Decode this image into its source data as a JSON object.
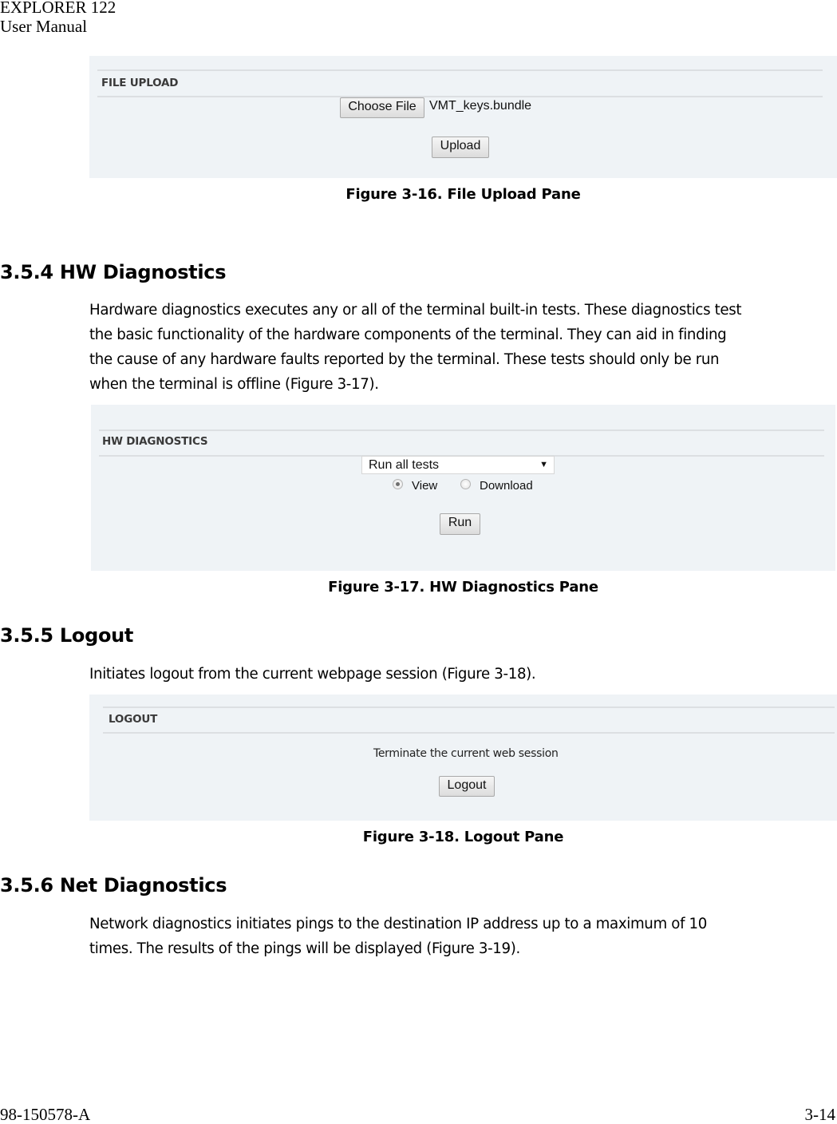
{
  "header": {
    "product": "EXPLORER 122",
    "doc_type": "User Manual"
  },
  "figures": {
    "file_upload": {
      "pane_title": "FILE UPLOAD",
      "choose_file_label": "Choose File",
      "selected_file": "VMT_keys.bundle",
      "upload_label": "Upload",
      "caption": "Figure 3-16. File Upload Pane"
    },
    "hw_diagnostics": {
      "pane_title": "HW DIAGNOSTICS",
      "test_select_value": "Run all tests",
      "test_select_arrow": "▼",
      "output_options": [
        {
          "label": "View",
          "checked": true
        },
        {
          "label": "Download",
          "checked": false
        }
      ],
      "run_label": "Run",
      "caption": "Figure 3-17. HW Diagnostics Pane"
    },
    "logout": {
      "pane_title": "LOGOUT",
      "description": "Terminate the current web session",
      "logout_label": "Logout",
      "caption": "Figure 3-18. Logout Pane"
    }
  },
  "sections": {
    "hw_diagnostics": {
      "heading": "3.5.4 HW Diagnostics",
      "lines": [
        "Hardware diagnostics executes any or all of the terminal built-in tests. These diagnostics test",
        "the basic functionality of the hardware components of the terminal. They can aid in finding",
        "the cause of any hardware faults reported by the terminal. These tests should only be run",
        "when the terminal is offline (Figure 3-17)."
      ]
    },
    "logout": {
      "heading": "3.5.5 Logout",
      "lines": [
        "Initiates logout from the current webpage session (Figure 3-18)."
      ]
    },
    "net_diagnostics": {
      "heading": "3.5.6 Net Diagnostics",
      "lines": [
        "Network diagnostics initiates pings to the destination IP address up to a maximum of 10",
        "times. The results of the pings will be displayed (Figure 3-19)."
      ]
    }
  },
  "footer": {
    "doc_number": "98-150578-A",
    "page_number": "3-14"
  }
}
